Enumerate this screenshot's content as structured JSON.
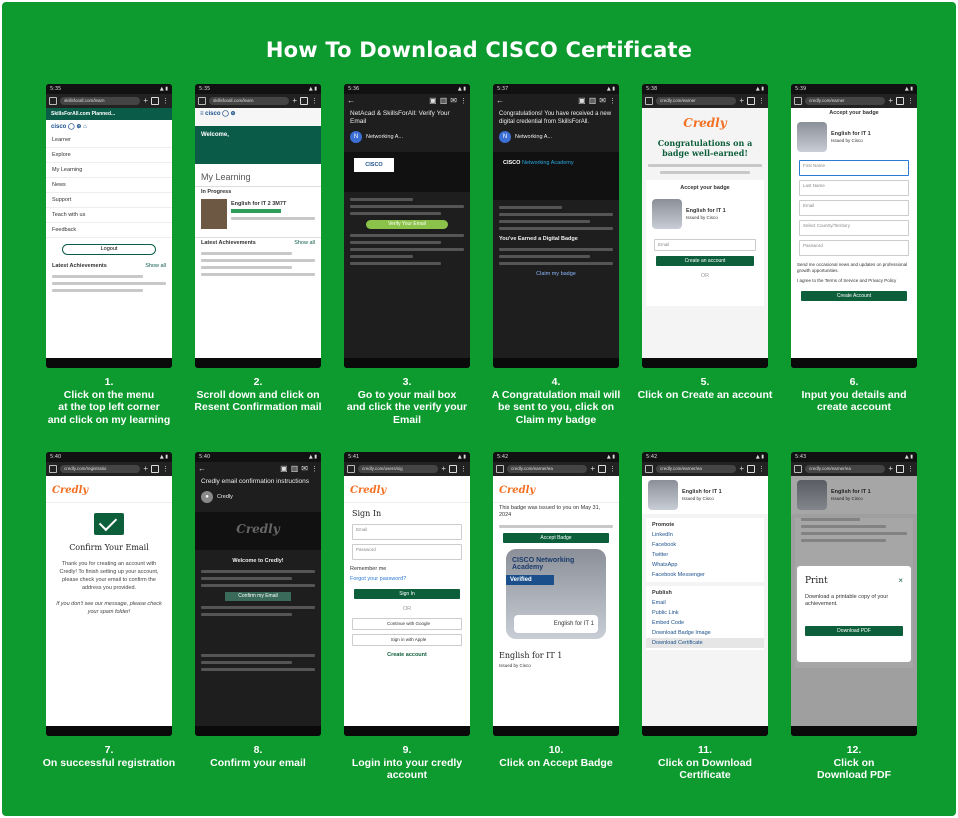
{
  "title": "How To Download CISCO Certificate",
  "colors": {
    "background": "#0d9a2f",
    "credly_orange": "#f36f21",
    "button_green": "#0d5e3b"
  },
  "steps": [
    {
      "num": "1.",
      "caption": [
        "Click on the menu",
        "at the top left corner",
        "and click on my learning"
      ],
      "screen": {
        "url": "skillsforall.com/learn",
        "top": "SkillsForAll.com Planned...",
        "items": [
          "Learner",
          "Explore",
          "My Learning",
          "News",
          "Support",
          "Teach with us",
          "Feedback"
        ],
        "button": "Logout",
        "section": "Latest Achievements",
        "link": "Show all"
      }
    },
    {
      "num": "2.",
      "caption": [
        "Scroll down and click on",
        "Resent Confirmation mail"
      ],
      "screen": {
        "url": "skillsforall.com/learn",
        "welcome": "Welcome,",
        "heading": "My Learning",
        "sub": "In Progress",
        "course": "English for IT 2 3M7T",
        "section": "Latest Achievements",
        "link": "Show all"
      }
    },
    {
      "num": "3.",
      "caption": [
        "Go to your mail box",
        "and click the verify your",
        "Email"
      ],
      "screen": {
        "subject": "NetAcad & SkillsForAll: Verify Your Email",
        "sender": "Networking A...",
        "brand": "CISCO",
        "button": "Verify Your Email"
      }
    },
    {
      "num": "4.",
      "caption": [
        "A Congratulation mail will",
        "be sent to you, click on",
        "Claim my badge"
      ],
      "screen": {
        "subject": "Congratulations! You have received a new digital credential from SkillsForAll.",
        "sender": "Networking A...",
        "brand": "CISCO",
        "sub": "Networking Academy",
        "heading": "You've Earned a Digital Badge",
        "link": "Claim my badge"
      }
    },
    {
      "num": "5.",
      "caption": [
        "Click on Create an account"
      ],
      "screen": {
        "url": "credly.com/earner",
        "logo": "Credly",
        "heading": "Congratulations on a badge well-earned!",
        "panel": "Accept your badge",
        "badge": "English for IT 1",
        "issuer": "Issued by Cisco",
        "field": "Email",
        "button": "Create an account",
        "or": "OR"
      }
    },
    {
      "num": "6.",
      "caption": [
        "Input you details and",
        "create account"
      ],
      "screen": {
        "url": "credly.com/earner",
        "panel": "Accept your badge",
        "badge": "English for IT 1",
        "issuer": "Issued by Cisco",
        "fields": [
          "First Name",
          "Last Name",
          "Email",
          "Select Country/Territory",
          "Password"
        ],
        "check1": "Send me occasional news and updates on professional growth opportunities.",
        "check2": "I agree to the Terms of Service and Privacy Policy",
        "button": "Create Account"
      }
    },
    {
      "num": "7.",
      "caption": [
        "On successful registration"
      ],
      "screen": {
        "url": "credly.com/registratio",
        "logo": "Credly",
        "heading": "Confirm Your Email",
        "text": "Thank you for creating an account with Credly! To finish setting up your account, please check your email to confirm the address you provided.",
        "text2": "If you don't see our message, please check your spam folder!"
      }
    },
    {
      "num": "8.",
      "caption": [
        "Confirm your email"
      ],
      "screen": {
        "subject": "Credly email confirmation instructions",
        "sender": "Credly",
        "logo": "Credly",
        "heading": "Welcome to Credly!",
        "button": "Confirm my Email"
      }
    },
    {
      "num": "9.",
      "caption": [
        "Login into your credly",
        "account"
      ],
      "screen": {
        "url": "credly.com/users/sig",
        "logo": "Credly",
        "heading": "Sign In",
        "fields": [
          "Email",
          "Password"
        ],
        "remember": "Remember me",
        "forgot": "Forgot your password?",
        "button": "Sign In",
        "or": "OR",
        "google": "Continue with Google",
        "apple": "Sign in with Apple",
        "create": "Create account"
      }
    },
    {
      "num": "10.",
      "caption": [
        "Click on Accept Badge"
      ],
      "screen": {
        "url": "credly.com/earner/ea",
        "logo": "Credly",
        "text": "This badge was issued to you on May 31, 2024",
        "button": "Accept Badge",
        "badge_top": "CISCO Networking Academy",
        "verified": "Verified",
        "badge_name": "English for IT 1",
        "title": "English for IT 1",
        "issuer": "Issued by Cisco"
      }
    },
    {
      "num": "11.",
      "caption": [
        "Click on Download",
        "Certificate"
      ],
      "screen": {
        "url": "credly.com/earner/ea",
        "badge": "English for IT 1",
        "issuer": "Issued by Cisco",
        "promote": "Promote",
        "socials": [
          "LinkedIn",
          "Facebook",
          "Twitter",
          "WhatsApp",
          "Facebook Messenger"
        ],
        "publish": "Publish",
        "options": [
          "Email",
          "Public Link",
          "Embed Code",
          "Download Badge Image",
          "Download Certificate"
        ]
      }
    },
    {
      "num": "12.",
      "caption": [
        "Click on",
        "Download PDF"
      ],
      "screen": {
        "url": "credly.com/earner/ea",
        "badge": "English for IT 1",
        "issuer": "Issued by Cisco",
        "dialog_title": "Print",
        "dialog_text": "Download a printable copy of your achievement.",
        "button": "Download PDF"
      }
    }
  ]
}
